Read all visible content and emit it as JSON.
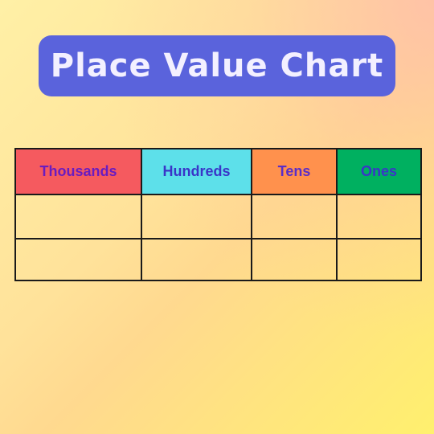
{
  "title": "Place Value Chart",
  "columns": [
    {
      "label": "Thousands",
      "bg": "#f55a5f",
      "text_color": "#6a1cc0"
    },
    {
      "label": "Hundreds",
      "bg": "#5de0ea",
      "text_color": "#3a35c8"
    },
    {
      "label": "Tens",
      "bg": "#ff914d",
      "text_color": "#5a2ec8"
    },
    {
      "label": "Ones",
      "bg": "#00b060",
      "text_color": "#3a35c8"
    }
  ],
  "rows": [
    [
      "",
      "",
      "",
      ""
    ],
    [
      "",
      "",
      "",
      ""
    ]
  ],
  "colors": {
    "banner": "#5a63dc",
    "title_text": "#f3f0ff",
    "border": "#1a1a1a"
  }
}
